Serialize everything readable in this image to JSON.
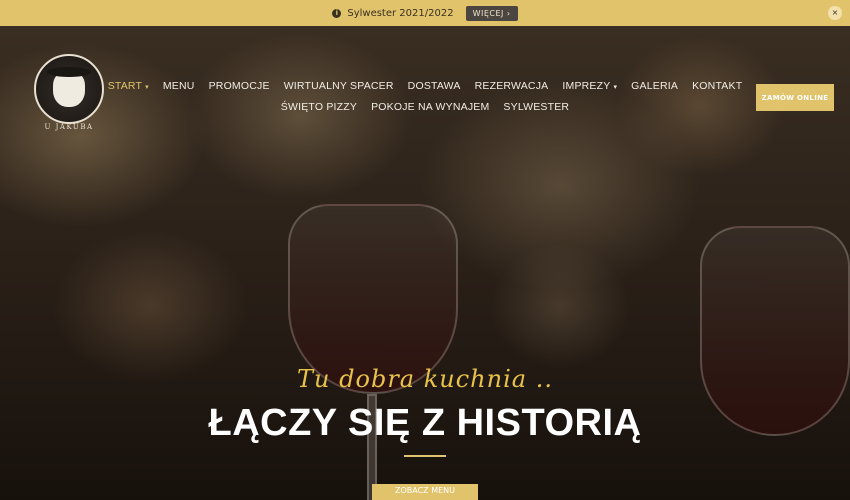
{
  "topbar": {
    "message": "Sylwester 2021/2022",
    "more_label": "WIĘCEJ ›",
    "close_label": "×",
    "info_icon": "i"
  },
  "brand": {
    "name": "U JAKUBA"
  },
  "nav": {
    "row1": [
      {
        "label": "START",
        "dropdown": true,
        "active": true
      },
      {
        "label": "MENU"
      },
      {
        "label": "PROMOCJE"
      },
      {
        "label": "WIRTUALNY SPACER"
      },
      {
        "label": "DOSTAWA"
      },
      {
        "label": "REZERWACJA"
      },
      {
        "label": "IMPREZY",
        "dropdown": true
      },
      {
        "label": "GALERIA"
      },
      {
        "label": "KONTAKT"
      }
    ],
    "row2": [
      {
        "label": "ŚWIĘTO PIZZY"
      },
      {
        "label": "POKOJE NA WYNAJEM"
      },
      {
        "label": "SYLWESTER"
      }
    ],
    "caret": "▾"
  },
  "order_button": "ZAMÓW ONLINE",
  "hero": {
    "tagline": "Tu dobra kuchnia ..",
    "headline": "ŁĄCZY SIĘ Z HISTORIĄ",
    "cta": "ZOBACZ MENU"
  },
  "colors": {
    "accent": "#e1c36c",
    "tagline": "#e8c24a"
  }
}
